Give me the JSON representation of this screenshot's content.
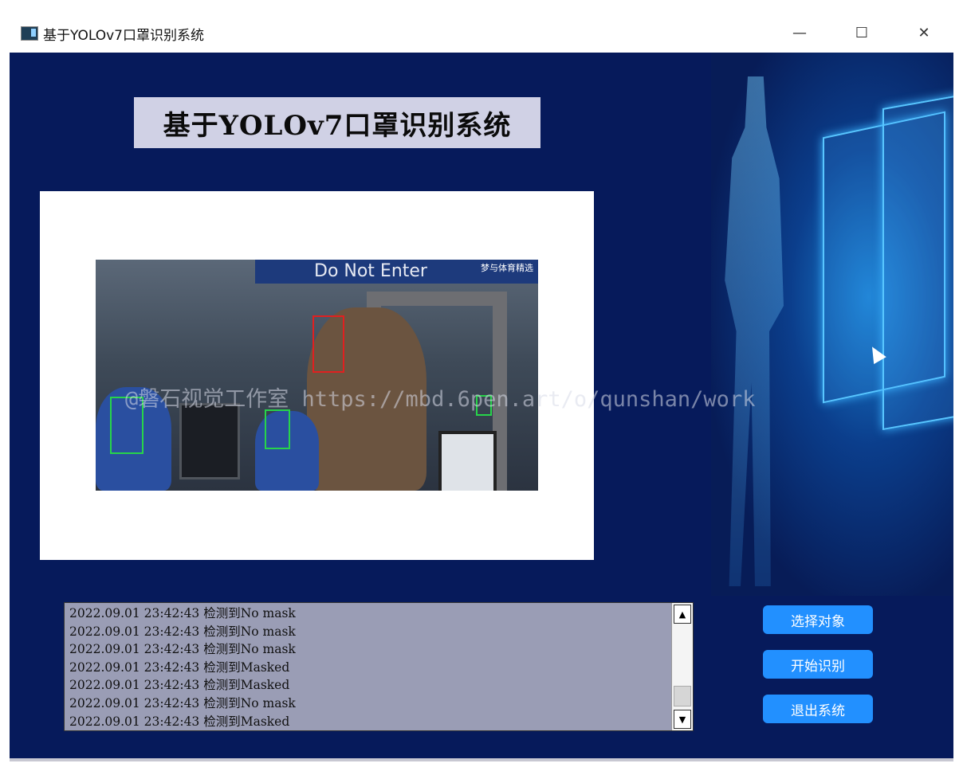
{
  "window": {
    "title": "基于YOLOv7口罩识别系统",
    "minimize_glyph": "—",
    "maximize_glyph": "☐",
    "close_glyph": "✕"
  },
  "header": {
    "title": "基于YOLOv7口罩识别系统"
  },
  "image_panel": {
    "banner_text": "Do Not Enter",
    "channel_tag": "梦与体育精选",
    "watermark": "@磐石视觉工作室 https://mbd.6pen.art/o/qunshan/work"
  },
  "log": {
    "lines": [
      "2022.09.01 23:42:43 检测到No mask",
      "2022.09.01 23:42:43 检测到No mask",
      "2022.09.01 23:42:43 检测到No mask",
      "2022.09.01 23:42:43 检测到Masked",
      "2022.09.01 23:42:43 检测到Masked",
      "2022.09.01 23:42:43 检测到No mask",
      "2022.09.01 23:42:43 检测到Masked"
    ],
    "scroll_up": "▲",
    "scroll_down": "▼"
  },
  "buttons": {
    "select": "选择对象",
    "start": "开始识别",
    "exit": "退出系统"
  },
  "colors": {
    "background": "#061a5b",
    "button": "#2290ff",
    "mask_box": "#27d44a",
    "no_mask_box": "#e02020"
  },
  "icons": [
    "app-icon",
    "minimize-icon",
    "maximize-icon",
    "close-icon",
    "scroll-up-icon",
    "scroll-down-icon"
  ]
}
